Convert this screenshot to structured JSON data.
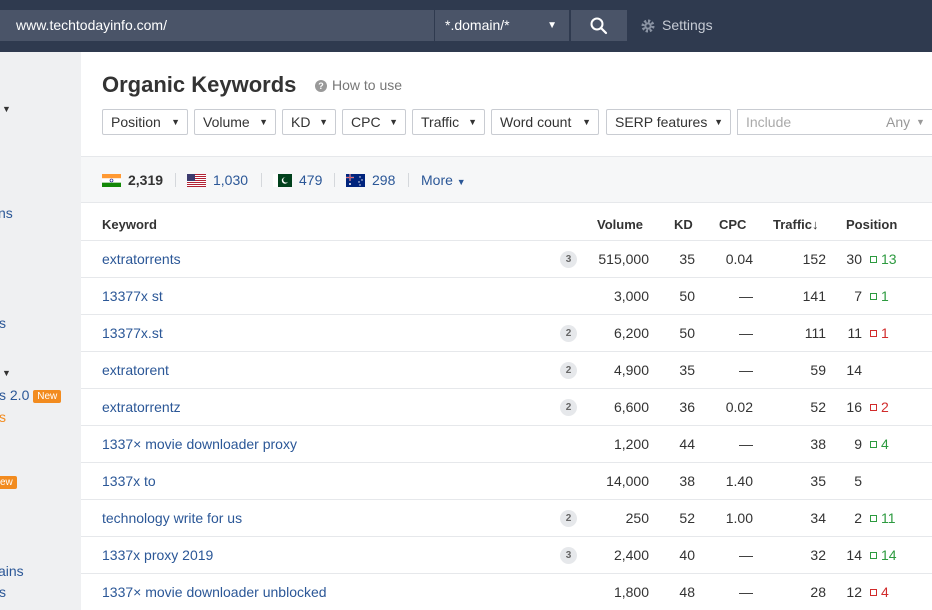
{
  "topbar": {
    "url": "www.techtodayinfo.com/",
    "mode": "*.domain/*",
    "settings_label": "Settings"
  },
  "sidebar": {
    "fragments": [
      "ns",
      "s",
      "s 2.0",
      "New",
      "s",
      "ew",
      "ains",
      "s"
    ]
  },
  "page": {
    "title": "Organic Keywords",
    "how_to_use": "How to use"
  },
  "filters": [
    {
      "label": "Position"
    },
    {
      "label": "Volume"
    },
    {
      "label": "KD"
    },
    {
      "label": "CPC"
    },
    {
      "label": "Traffic"
    },
    {
      "label": "Word count"
    },
    {
      "label": "SERP features"
    }
  ],
  "include": {
    "placeholder": "Include",
    "any": "Any"
  },
  "countries": [
    {
      "flag": "india",
      "count": "2,319"
    },
    {
      "flag": "usa",
      "count": "1,030"
    },
    {
      "flag": "pakistan",
      "count": "479"
    },
    {
      "flag": "australia",
      "count": "298"
    }
  ],
  "more_label": "More",
  "table": {
    "headers": {
      "keyword": "Keyword",
      "volume": "Volume",
      "kd": "KD",
      "cpc": "CPC",
      "traffic": "Traffic",
      "traffic_sort": "↓",
      "position": "Position"
    },
    "rows": [
      {
        "keyword": "extratorrents",
        "serp": "3",
        "volume": "515,000",
        "kd": "35",
        "cpc": "0.04",
        "traffic": "152",
        "position": "30",
        "change": "13",
        "dir": "up"
      },
      {
        "keyword": "13377x st",
        "serp": "",
        "volume": "3,000",
        "kd": "50",
        "cpc": "—",
        "traffic": "141",
        "position": "7",
        "change": "1",
        "dir": "up"
      },
      {
        "keyword": "13377x.st",
        "serp": "2",
        "volume": "6,200",
        "kd": "50",
        "cpc": "—",
        "traffic": "111",
        "position": "11",
        "change": "1",
        "dir": "down"
      },
      {
        "keyword": "extratorent",
        "serp": "2",
        "volume": "4,900",
        "kd": "35",
        "cpc": "—",
        "traffic": "59",
        "position": "14",
        "change": "",
        "dir": ""
      },
      {
        "keyword": "extratorrentz",
        "serp": "2",
        "volume": "6,600",
        "kd": "36",
        "cpc": "0.02",
        "traffic": "52",
        "position": "16",
        "change": "2",
        "dir": "down"
      },
      {
        "keyword": "1337× movie downloader proxy",
        "serp": "",
        "volume": "1,200",
        "kd": "44",
        "cpc": "—",
        "traffic": "38",
        "position": "9",
        "change": "4",
        "dir": "up"
      },
      {
        "keyword": "1337x to",
        "serp": "",
        "volume": "14,000",
        "kd": "38",
        "cpc": "1.40",
        "traffic": "35",
        "position": "5",
        "change": "",
        "dir": ""
      },
      {
        "keyword": "technology write for us",
        "serp": "2",
        "volume": "250",
        "kd": "52",
        "cpc": "1.00",
        "traffic": "34",
        "position": "2",
        "change": "11",
        "dir": "up"
      },
      {
        "keyword": "1337x proxy 2019",
        "serp": "3",
        "volume": "2,400",
        "kd": "40",
        "cpc": "—",
        "traffic": "32",
        "position": "14",
        "change": "14",
        "dir": "up"
      },
      {
        "keyword": "1337× movie downloader unblocked",
        "serp": "",
        "volume": "1,800",
        "kd": "48",
        "cpc": "—",
        "traffic": "28",
        "position": "12",
        "change": "4",
        "dir": "down"
      }
    ]
  },
  "colors": {
    "link": "#2b5797",
    "up": "#2c9a3f",
    "down": "#d12b2b",
    "topbar": "#2f3a4f",
    "new_badge": "#f28b1f"
  }
}
